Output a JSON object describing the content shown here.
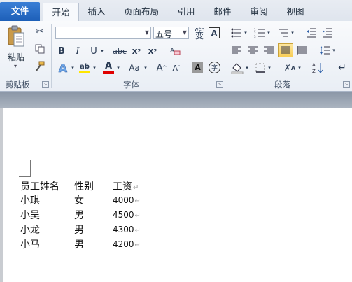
{
  "tabs": [
    "文件",
    "开始",
    "插入",
    "页面布局",
    "引用",
    "邮件",
    "审阅",
    "视图"
  ],
  "clipboard": {
    "paste_label": "粘贴",
    "group_label": "剪贴板"
  },
  "font": {
    "name_value": "",
    "size_value": "五号",
    "group_label": "字体",
    "wen_label": "wén",
    "wen_char": "变"
  },
  "paragraph": {
    "group_label": "段落"
  },
  "document": {
    "header": [
      "员工姓名",
      "性别",
      "工资"
    ],
    "rows": [
      [
        "小琪",
        "女",
        "4000"
      ],
      [
        "小吴",
        "男",
        "4500"
      ],
      [
        "小龙",
        "男",
        "4300"
      ],
      [
        "小马",
        "男",
        "4200"
      ]
    ],
    "para_mark": "↵"
  },
  "colors": {
    "file_tab": "#1d5fb8",
    "highlight": "#ffe600",
    "font_color": "#e00000",
    "selected_button": "#f8cd55"
  }
}
